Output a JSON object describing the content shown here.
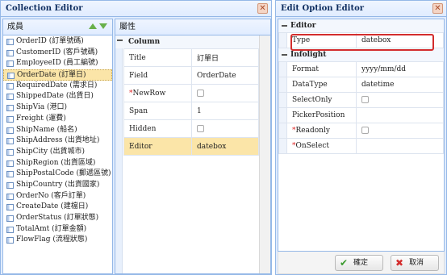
{
  "collection_editor": {
    "title": "Collection Editor",
    "members_header": "成員",
    "properties_header": "屬性",
    "members": [
      "OrderID (訂單號碼)",
      "CustomerID (客戶號碼)",
      "EmployeeID (員工編號)",
      "OrderDate (訂單日)",
      "RequiredDate (需求日)",
      "ShippedDate (出貨日)",
      "ShipVia (港口)",
      "Freight (運費)",
      "ShipName (船名)",
      "ShipAddress (出貨地址)",
      "ShipCity (出貨城市)",
      "ShipRegion (出貨區域)",
      "ShipPostalCode (郵遞區號)",
      "ShipCountry (出貨國家)",
      "OrderNo (客戶訂單)",
      "CreateDate (建檔日)",
      "OrderStatus (訂單狀態)",
      "TotalAmt (訂單金額)",
      "FlowFlag (流程狀態)"
    ],
    "selected_member_index": 3,
    "property_group": "Column",
    "properties": [
      {
        "name": "Title",
        "value": "訂單日",
        "required": false
      },
      {
        "name": "Field",
        "value": "OrderDate",
        "required": false
      },
      {
        "name": "NewRow",
        "value": "",
        "required": true,
        "checkbox": true
      },
      {
        "name": "Span",
        "value": "1",
        "required": false
      },
      {
        "name": "Hidden",
        "value": "",
        "required": false,
        "checkbox": true
      },
      {
        "name": "Editor",
        "value": "datebox",
        "required": false,
        "selected": true
      }
    ]
  },
  "edit_option_editor": {
    "title": "Edit Option Editor",
    "group_editor": "Editor",
    "editor_rows": [
      {
        "name": "Type",
        "value": "datebox"
      }
    ],
    "group_infolight": "Infolight",
    "infolight_rows": [
      {
        "name": "Format",
        "value": "yyyy/mm/dd"
      },
      {
        "name": "DataType",
        "value": "datetime"
      },
      {
        "name": "SelectOnly",
        "value": ""
      },
      {
        "name": "PickerPosition",
        "value": ""
      },
      {
        "name": "Readonly",
        "value": ""
      },
      {
        "name": "OnSelect",
        "value": ""
      }
    ],
    "ok_label": "確定",
    "cancel_label": "取消"
  },
  "colors": {
    "accent": "#95b8e7",
    "selected": "#fbe5a8",
    "highlight_border": "#d32d2d"
  }
}
